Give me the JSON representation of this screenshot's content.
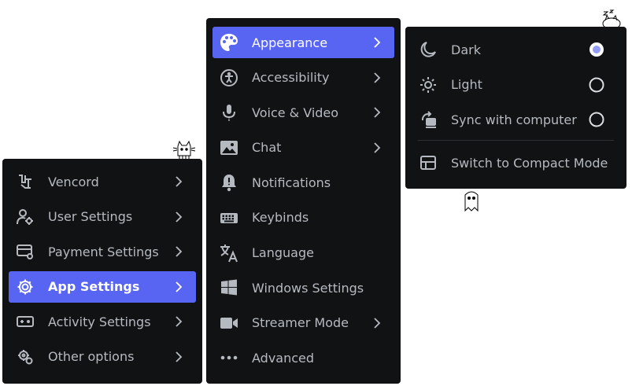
{
  "menu_main": {
    "items": [
      {
        "label": "Vencord",
        "icon": "vencord-icon"
      },
      {
        "label": "User Settings",
        "icon": "user-gear-icon"
      },
      {
        "label": "Payment Settings",
        "icon": "card-gear-icon"
      },
      {
        "label": "App Settings",
        "icon": "gear-icon",
        "active": true
      },
      {
        "label": "Activity Settings",
        "icon": "gamepad-icon"
      },
      {
        "label": "Other options",
        "icon": "gears-icon"
      }
    ]
  },
  "menu_app": {
    "items": [
      {
        "label": "Appearance",
        "icon": "palette-icon",
        "active": true,
        "submenu": true
      },
      {
        "label": "Accessibility",
        "icon": "accessibility-icon",
        "submenu": true
      },
      {
        "label": "Voice & Video",
        "icon": "microphone-icon",
        "submenu": true
      },
      {
        "label": "Chat",
        "icon": "image-icon",
        "submenu": true
      },
      {
        "label": "Notifications",
        "icon": "bell-icon",
        "submenu": false
      },
      {
        "label": "Keybinds",
        "icon": "keyboard-icon",
        "submenu": false
      },
      {
        "label": "Language",
        "icon": "translate-icon",
        "submenu": false
      },
      {
        "label": "Windows Settings",
        "icon": "windows-icon",
        "submenu": false
      },
      {
        "label": "Streamer Mode",
        "icon": "camera-icon",
        "submenu": true
      },
      {
        "label": "Advanced",
        "icon": "more-dots-icon",
        "submenu": false
      }
    ]
  },
  "menu_appearance": {
    "themes": [
      {
        "label": "Dark",
        "icon": "moon-icon",
        "selected": true
      },
      {
        "label": "Light",
        "icon": "sun-icon",
        "selected": false
      },
      {
        "label": "Sync with computer",
        "icon": "sync-icon",
        "selected": false
      }
    ],
    "compact_label": "Switch to Compact Mode"
  },
  "colors": {
    "menu_bg": "#111214",
    "active_bg": "#5865f2",
    "text": "#b5bac1",
    "active_text": "#ffffff",
    "radio_selected": "#949cf7"
  }
}
